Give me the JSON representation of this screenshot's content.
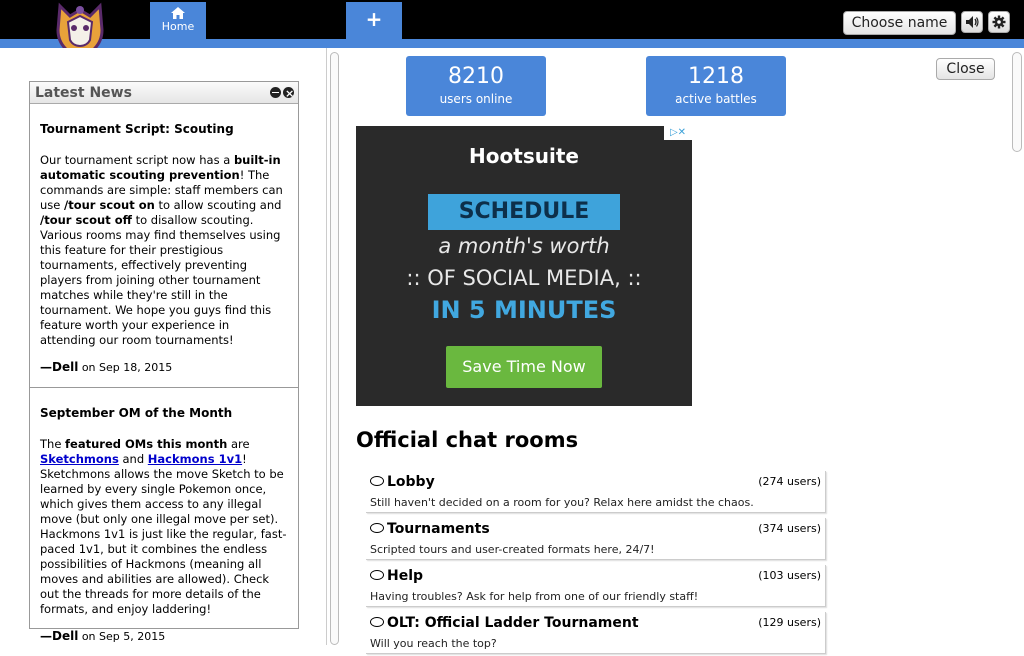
{
  "header": {
    "tabs": [
      {
        "label": "Home",
        "icon": "home-icon"
      },
      {
        "label": "+",
        "icon": "plus-icon"
      }
    ],
    "choose_name_label": "Choose name",
    "colors": {
      "bar": "#000000",
      "accent": "#4a86d9"
    }
  },
  "stats": {
    "users_online": {
      "value": "8210",
      "label": "users online"
    },
    "active_battles": {
      "value": "1218",
      "label": "active battles"
    }
  },
  "close_label": "Close",
  "news": {
    "title": "Latest News",
    "items": [
      {
        "title": "Tournament Script: Scouting",
        "body_parts": [
          "Our tournament script now has a ",
          "built-in automatic scouting prevention",
          "! The commands are simple: staff members can use ",
          "/tour scout on",
          " to allow scouting and ",
          "/tour scout off",
          " to disallow scouting. Various rooms may find themselves using this feature for their prestigious tournaments, effectively preventing players from joining other tournament matches while they're still in the tournament. We hope you guys find this feature worth your experience in attending our room tournaments!"
        ],
        "author": "—Dell",
        "date": "on Sep 18, 2015"
      },
      {
        "title": "September OM of the Month",
        "body_parts": [
          "The ",
          "featured OMs this month",
          " are ",
          "Sketchmons",
          " and ",
          "Hackmons 1v1",
          "! Sketchmons allows the move Sketch to be learned by every single Pokemon once, which gives them access to any illegal move (but only one illegal move per set). Hackmons 1v1 is just like the regular, fast-paced 1v1, but it combines the endless possibilities of Hackmons (meaning all moves and abilities are allowed). Check out the threads for more details of the formats, and enjoy laddering!"
        ],
        "author": "—Dell",
        "date": "on Sep 5, 2015"
      }
    ]
  },
  "ad": {
    "brand": "Hootsuite",
    "ribbon": "SCHEDULE",
    "line1": "a month's worth",
    "line2": ":: OF SOCIAL MEDIA, ::",
    "line3": "IN 5 MINUTES",
    "cta": "Save Time Now",
    "marks": "▷✕"
  },
  "rooms": {
    "title": "Official chat rooms",
    "items": [
      {
        "name": "Lobby",
        "users": "(274 users)",
        "desc": "Still haven't decided on a room for you? Relax here amidst the chaos."
      },
      {
        "name": "Tournaments",
        "users": "(374 users)",
        "desc": "Scripted tours and user-created formats here, 24/7!"
      },
      {
        "name": "Help",
        "users": "(103 users)",
        "desc": "Having troubles? Ask for help from one of our friendly staff!"
      },
      {
        "name": "OLT: Official Ladder Tournament",
        "users": "(129 users)",
        "desc": "Will you reach the top?"
      }
    ]
  }
}
